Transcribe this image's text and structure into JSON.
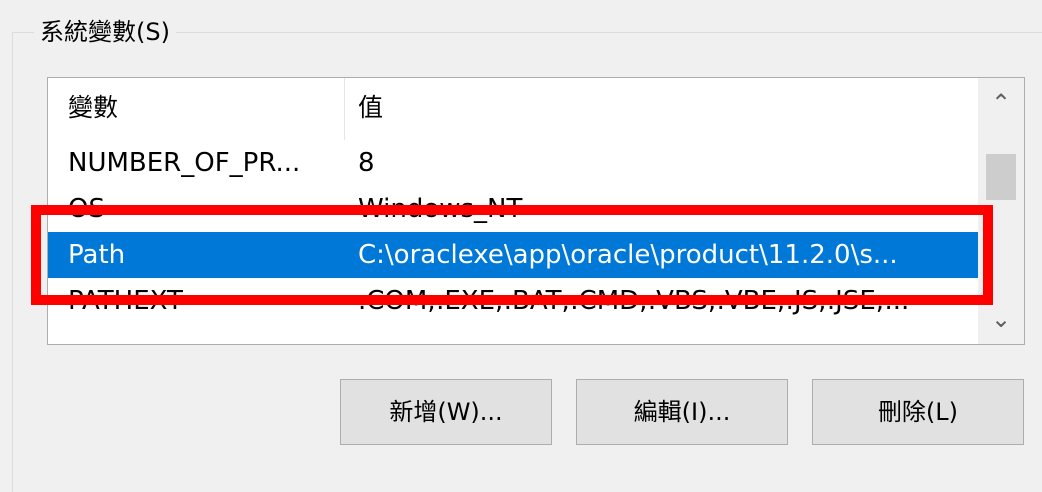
{
  "group": {
    "title": "系統變數(S)"
  },
  "list": {
    "headers": {
      "variable": "變數",
      "value": "值"
    },
    "rows": [
      {
        "variable": "NUMBER_OF_PR...",
        "value": "8",
        "selected": false
      },
      {
        "variable": "OS",
        "value": "Windows_NT",
        "selected": false
      },
      {
        "variable": "Path",
        "value": "C:\\oraclexe\\app\\oracle\\product\\11.2.0\\s...",
        "selected": true
      },
      {
        "variable": "PATHEXT",
        "value": ".COM;.EXE;.BAT;.CMD;.VBS;.VBE;.JS;.JSE;...",
        "selected": false
      }
    ]
  },
  "scrollbar": {
    "up_icon": "chevron-up-icon",
    "down_icon": "chevron-down-icon",
    "up_glyph": "⌃",
    "down_glyph": "⌄"
  },
  "buttons": {
    "new_label": "新增(W)...",
    "edit_label": "編輯(I)...",
    "delete_label": "刪除(L)"
  },
  "colors": {
    "selection": "#0078d7",
    "highlight_border": "#ff0000",
    "window_background": "#f0f0f0"
  }
}
